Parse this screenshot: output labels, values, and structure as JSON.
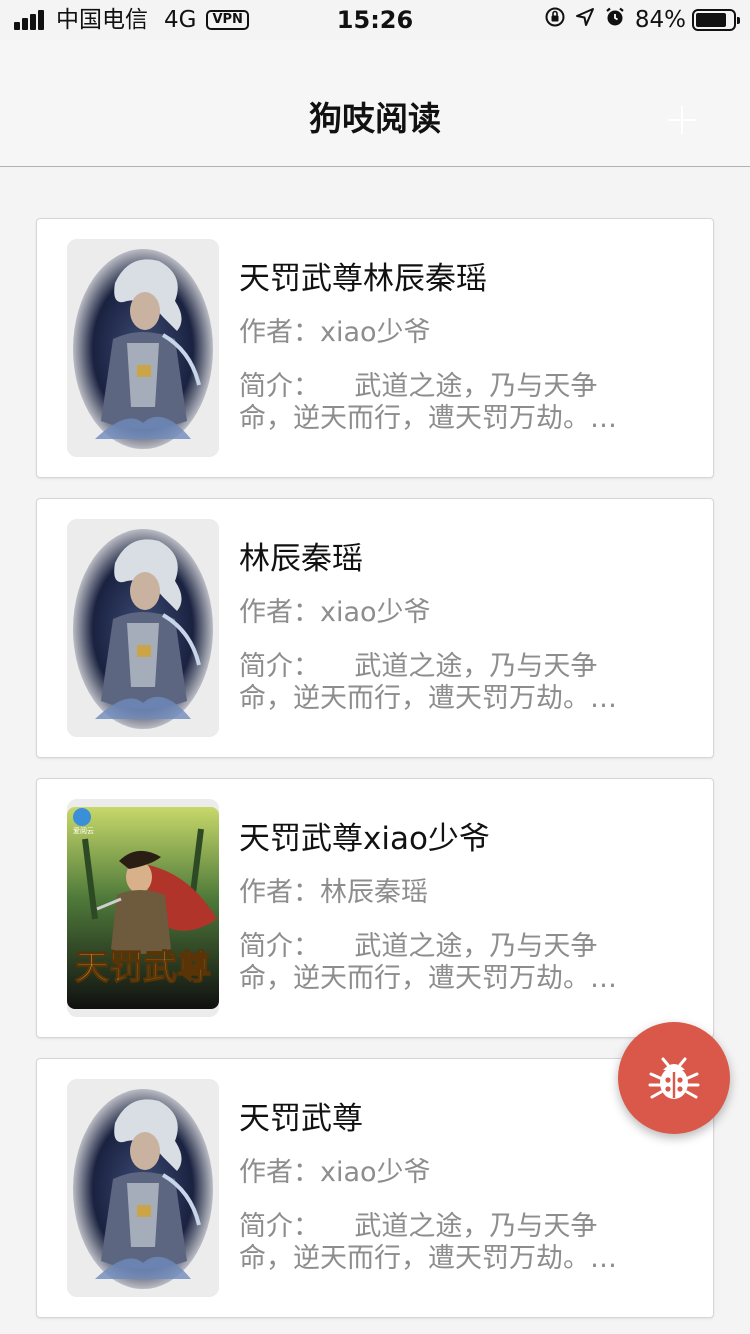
{
  "status_bar": {
    "carrier": "中国电信",
    "network": "4G",
    "vpn": "VPN",
    "time": "15:26",
    "battery_pct": "84%",
    "battery_level": 0.84,
    "icons": [
      "orientation-lock-icon",
      "location-icon",
      "alarm-icon"
    ]
  },
  "nav": {
    "title": "狗吱阅读",
    "add_icon": "plus-icon"
  },
  "books": [
    {
      "title": "天罚武尊林辰秦瑶",
      "author": "作者：xiao少爷",
      "intro": "简介：    武道之途，乃与天争命，逆天而行，遭天罚万劫。…",
      "cover": "warrior-portrait-cover"
    },
    {
      "title": "林辰秦瑶",
      "author": "作者：xiao少爷",
      "intro": "简介：    武道之途，乃与天争命，逆天而行，遭天罚万劫。…",
      "cover": "warrior-portrait-cover"
    },
    {
      "title": "天罚武尊xiao少爷",
      "author": "作者：林辰秦瑶",
      "intro": "简介：    武道之途，乃与天争命，逆天而行，遭天罚万劫。…",
      "cover": "tianfa-wuzun-cover",
      "cover_text": "天罚武尊",
      "cover_badge": "爱阅云"
    },
    {
      "title": "天罚武尊",
      "author": "作者：xiao少爷",
      "intro": "简介：    武道之途，乃与天争命，逆天而行，遭天罚万劫。…",
      "cover": "warrior-portrait-cover"
    }
  ],
  "fab": {
    "icon": "bug-icon",
    "color": "#d9584a"
  }
}
